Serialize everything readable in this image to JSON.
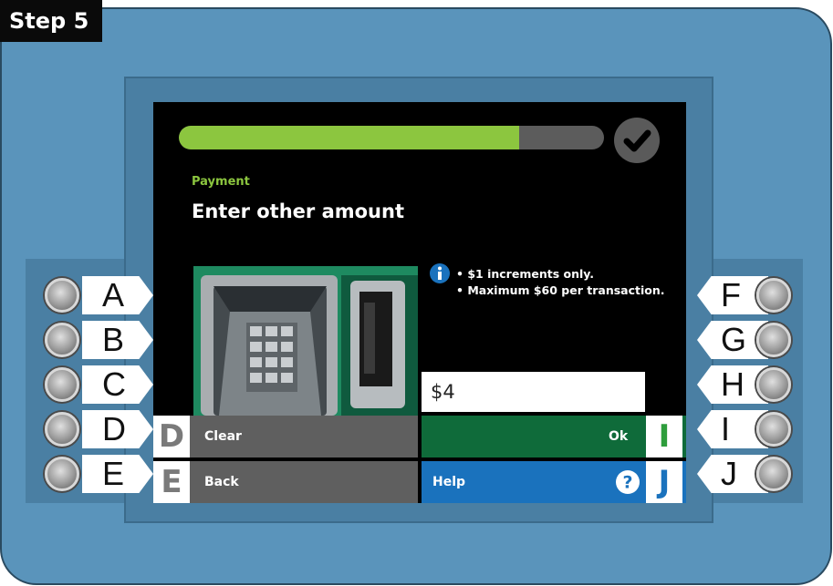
{
  "step_label": "Step 5",
  "progress_percent": 80,
  "section_label": "Payment",
  "screen_title": "Enter other amount",
  "notes": [
    "• $1 increments only.",
    "• Maximum $60 per transaction."
  ],
  "amount_value": "$4",
  "buttons": {
    "clear": {
      "key": "D",
      "label": "Clear"
    },
    "back": {
      "key": "E",
      "label": "Back"
    },
    "ok": {
      "key": "I",
      "label": "Ok"
    },
    "help": {
      "key": "J",
      "label": "Help"
    }
  },
  "side_keys_left": [
    "A",
    "B",
    "C",
    "D",
    "E"
  ],
  "side_keys_right": [
    "F",
    "G",
    "H",
    "I",
    "J"
  ],
  "colors": {
    "kiosk_blue": "#5a94bb",
    "progress_green": "#8cc63f",
    "ok_green": "#0f6b3a",
    "help_blue": "#1a72bd",
    "neutral_button": "#5f5f5f"
  },
  "icons": [
    "check-icon",
    "info-icon",
    "help-icon",
    "atm-keypad-photo"
  ]
}
